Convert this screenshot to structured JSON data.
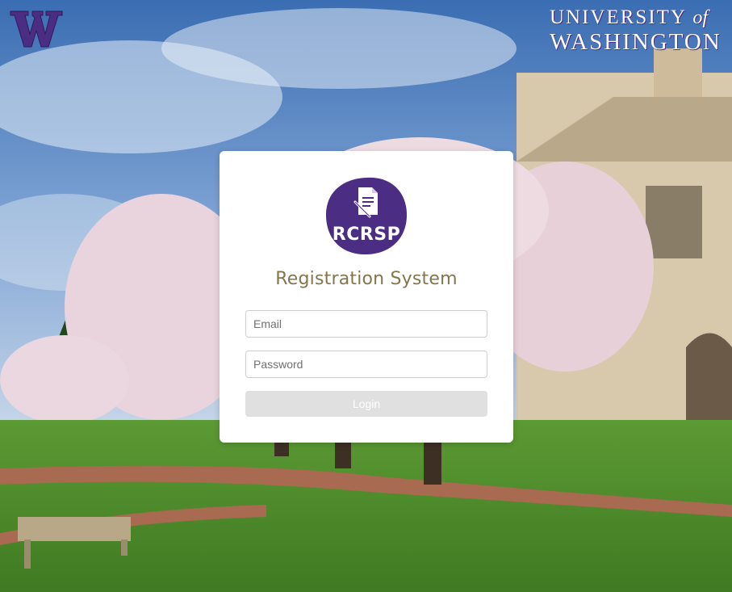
{
  "brand": {
    "w_logo_icon": "uw-w-logo-icon",
    "university_line1": "UNIVERSITY",
    "university_of": "of",
    "university_line2": "WASHINGTON",
    "purple": "#4b2e83",
    "gold": "#85754d"
  },
  "login": {
    "logo_text": "RCRSP",
    "logo_icon": "document-pen-icon",
    "title": "Registration System",
    "email_placeholder": "Email",
    "password_placeholder": "Password",
    "login_label": "Login"
  }
}
